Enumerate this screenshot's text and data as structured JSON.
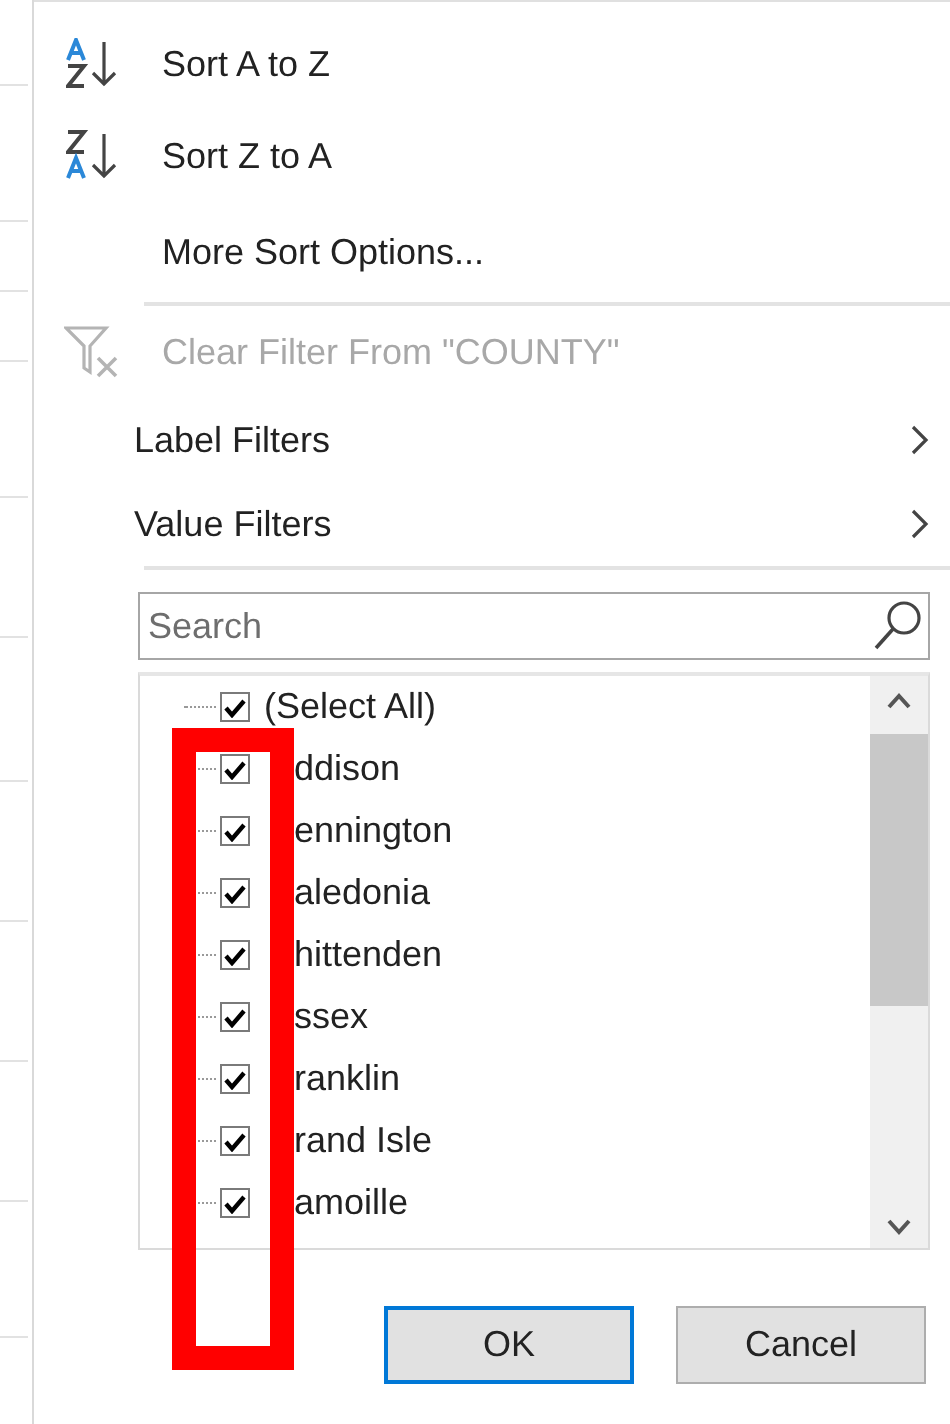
{
  "menu_items": [
    {
      "kind": "sort_ascending",
      "label": "Sort A to Z",
      "disabled": false
    },
    {
      "kind": "sort_descending",
      "label": "Sort Z to A",
      "disabled": false
    },
    {
      "kind": "plain",
      "label": "More Sort Options...",
      "disabled": false
    },
    {
      "kind": "separator"
    },
    {
      "kind": "clear_filter",
      "label": "Clear Filter From \"COUNTY\"",
      "disabled": true
    },
    {
      "kind": "submenu",
      "label": "Label Filters",
      "disabled": false
    },
    {
      "kind": "submenu",
      "label": "Value Filters",
      "disabled": false
    },
    {
      "kind": "separator"
    }
  ],
  "search": {
    "placeholder": "Search"
  },
  "values": [
    {
      "kind": "select_all",
      "label": "(Select All)",
      "checked": true
    },
    {
      "kind": "value",
      "label": "ddison",
      "checked": true
    },
    {
      "kind": "value",
      "label": "ennington",
      "checked": true
    },
    {
      "kind": "value",
      "label": "aledonia",
      "checked": true
    },
    {
      "kind": "value",
      "label": "hittenden",
      "checked": true
    },
    {
      "kind": "value",
      "label": "ssex",
      "checked": true
    },
    {
      "kind": "value",
      "label": "ranklin",
      "checked": true
    },
    {
      "kind": "value",
      "label": "rand Isle",
      "checked": true
    },
    {
      "kind": "value",
      "label": "amoille",
      "checked": true
    }
  ],
  "buttons": [
    {
      "label": "OK",
      "default": true
    },
    {
      "label": "Cancel",
      "default": false
    }
  ],
  "annotation": {
    "kind": "highlight_rectangle"
  }
}
